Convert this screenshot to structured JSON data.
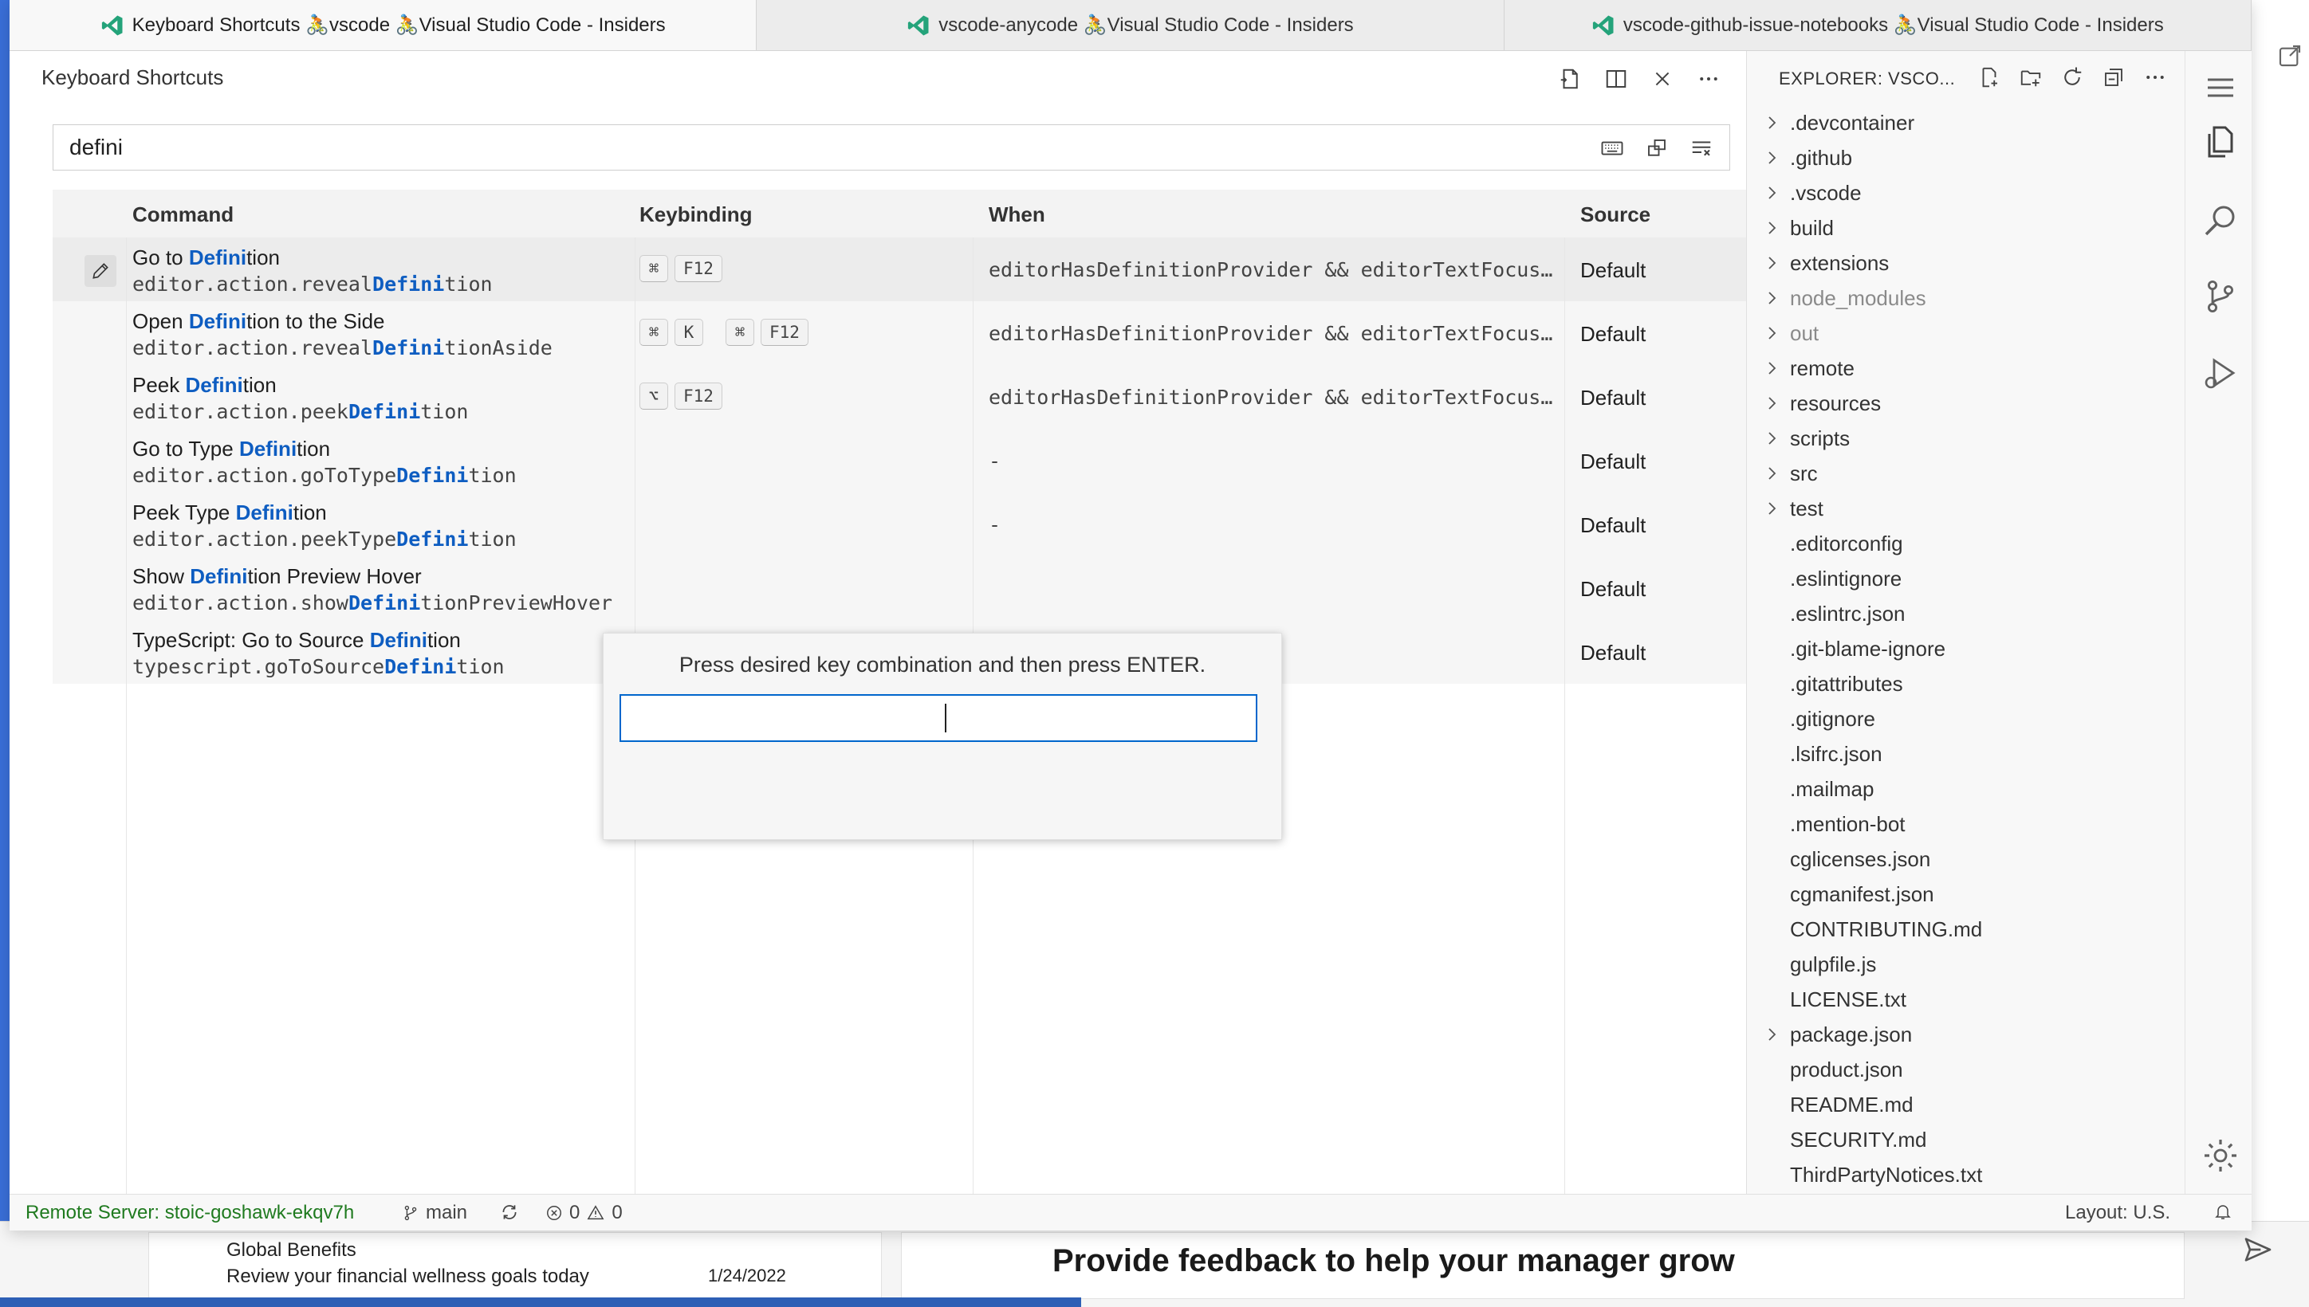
{
  "window_tabs": [
    {
      "label": "Keyboard Shortcuts 🚴vscode 🚴Visual Studio Code - Insiders",
      "active": true
    },
    {
      "label": "vscode-anycode 🚴Visual Studio Code - Insiders",
      "active": false
    },
    {
      "label": "vscode-github-issue-notebooks 🚴Visual Studio Code - Insiders",
      "active": false
    }
  ],
  "editor": {
    "title": "Keyboard Shortcuts",
    "search_value": "defini",
    "columns": {
      "command": "Command",
      "keybinding": "Keybinding",
      "when": "When",
      "source": "Source"
    },
    "rows": [
      {
        "title_pre": "Go to ",
        "title_hl": "Defini",
        "title_post": "tion",
        "id_pre": "editor.action.reveal",
        "id_hl": "Defini",
        "id_post": "tion",
        "keys": [
          [
            "⌘",
            "F12"
          ]
        ],
        "when": "editorHasDefinitionProvider && editorTextFocus &&…",
        "source": "Default"
      },
      {
        "title_pre": "Open ",
        "title_hl": "Defini",
        "title_post": "tion to the Side",
        "id_pre": "editor.action.reveal",
        "id_hl": "Defini",
        "id_post": "tionAside",
        "keys": [
          [
            "⌘",
            "K"
          ],
          [
            "⌘",
            "F12"
          ]
        ],
        "when": "editorHasDefinitionProvider && editorTextFocus &&…",
        "source": "Default"
      },
      {
        "title_pre": "Peek ",
        "title_hl": "Defini",
        "title_post": "tion",
        "id_pre": "editor.action.peek",
        "id_hl": "Defini",
        "id_post": "tion",
        "keys": [
          [
            "⌥",
            "F12"
          ]
        ],
        "when": "editorHasDefinitionProvider && editorTextFocus &&…",
        "source": "Default"
      },
      {
        "title_pre": "Go to Type ",
        "title_hl": "Defini",
        "title_post": "tion",
        "id_pre": "editor.action.goToType",
        "id_hl": "Defini",
        "id_post": "tion",
        "keys": [],
        "when": "-",
        "source": "Default"
      },
      {
        "title_pre": "Peek Type ",
        "title_hl": "Defini",
        "title_post": "tion",
        "id_pre": "editor.action.peekType",
        "id_hl": "Defini",
        "id_post": "tion",
        "keys": [],
        "when": "-",
        "source": "Default"
      },
      {
        "title_pre": "Show ",
        "title_hl": "Defini",
        "title_post": "tion Preview Hover",
        "id_pre": "editor.action.show",
        "id_hl": "Defini",
        "id_post": "tionPreviewHover",
        "keys": [],
        "when": "",
        "source": "Default"
      },
      {
        "title_pre": "TypeScript: Go to Source ",
        "title_hl": "Defini",
        "title_post": "tion",
        "id_pre": "typescript.goToSource",
        "id_hl": "Defini",
        "id_post": "tion",
        "keys": [],
        "when": "",
        "source": "Default"
      }
    ],
    "dialog_message": "Press desired key combination and then press ENTER."
  },
  "explorer": {
    "title": "EXPLORER: VSCO...",
    "items": [
      {
        "name": ".devcontainer",
        "folder": true,
        "dim": false
      },
      {
        "name": ".github",
        "folder": true,
        "dim": false
      },
      {
        "name": ".vscode",
        "folder": true,
        "dim": false
      },
      {
        "name": "build",
        "folder": true,
        "dim": false
      },
      {
        "name": "extensions",
        "folder": true,
        "dim": false
      },
      {
        "name": "node_modules",
        "folder": true,
        "dim": true
      },
      {
        "name": "out",
        "folder": true,
        "dim": true
      },
      {
        "name": "remote",
        "folder": true,
        "dim": false
      },
      {
        "name": "resources",
        "folder": true,
        "dim": false
      },
      {
        "name": "scripts",
        "folder": true,
        "dim": false
      },
      {
        "name": "src",
        "folder": true,
        "dim": false
      },
      {
        "name": "test",
        "folder": true,
        "dim": false
      },
      {
        "name": ".editorconfig",
        "folder": false,
        "dim": false
      },
      {
        "name": ".eslintignore",
        "folder": false,
        "dim": false
      },
      {
        "name": ".eslintrc.json",
        "folder": false,
        "dim": false
      },
      {
        "name": ".git-blame-ignore",
        "folder": false,
        "dim": false
      },
      {
        "name": ".gitattributes",
        "folder": false,
        "dim": false
      },
      {
        "name": ".gitignore",
        "folder": false,
        "dim": false
      },
      {
        "name": ".lsifrc.json",
        "folder": false,
        "dim": false
      },
      {
        "name": ".mailmap",
        "folder": false,
        "dim": false
      },
      {
        "name": ".mention-bot",
        "folder": false,
        "dim": false
      },
      {
        "name": "cglicenses.json",
        "folder": false,
        "dim": false
      },
      {
        "name": "cgmanifest.json",
        "folder": false,
        "dim": false
      },
      {
        "name": "CONTRIBUTING.md",
        "folder": false,
        "dim": false
      },
      {
        "name": "gulpfile.js",
        "folder": false,
        "dim": false
      },
      {
        "name": "LICENSE.txt",
        "folder": false,
        "dim": false
      },
      {
        "name": "package.json",
        "folder": true,
        "dim": false
      },
      {
        "name": "product.json",
        "folder": false,
        "dim": false
      },
      {
        "name": "README.md",
        "folder": false,
        "dim": false
      },
      {
        "name": "SECURITY.md",
        "folder": false,
        "dim": false
      },
      {
        "name": "ThirdPartyNotices.txt",
        "folder": false,
        "dim": false
      }
    ]
  },
  "statusbar": {
    "remote": "Remote Server: stoic-goshawk-ekqv7h",
    "branch": "main",
    "errors": "0",
    "warnings": "0",
    "layout": "Layout: U.S."
  },
  "background": {
    "row_title": "Global Benefits",
    "row_subtitle": "Review your financial wellness goals today",
    "row_date": "1/24/2022",
    "feedback_prompt": "Provide feedback to help your manager grow"
  },
  "colors": {
    "highlight": "#0e5dc1",
    "focus_border": "#0066cc",
    "remote_text": "#1f7a1f"
  }
}
